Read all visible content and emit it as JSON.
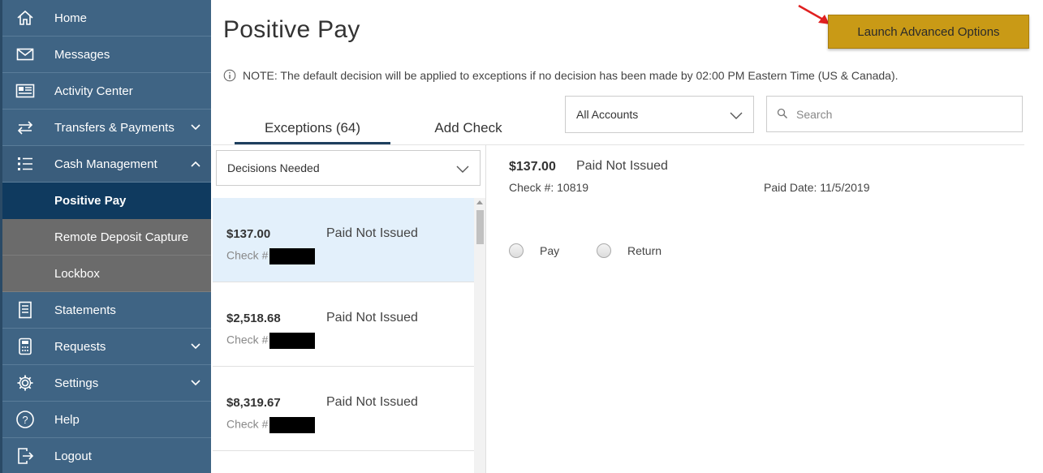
{
  "sidebar": {
    "items": [
      {
        "label": "Home",
        "icon": "home-icon",
        "chevron": false
      },
      {
        "label": "Messages",
        "icon": "envelope-icon",
        "chevron": false
      },
      {
        "label": "Activity Center",
        "icon": "newspaper-icon",
        "chevron": false
      },
      {
        "label": "Transfers & Payments",
        "icon": "transfer-arrows-icon",
        "chevron": true
      },
      {
        "label": "Cash Management",
        "icon": "list-icon",
        "chevron": true
      },
      {
        "label": "Positive Pay",
        "sub": true,
        "active": true
      },
      {
        "label": "Remote Deposit Capture",
        "sub": true
      },
      {
        "label": "Lockbox",
        "sub": true
      },
      {
        "label": "Statements",
        "icon": "document-icon",
        "chevron": false
      },
      {
        "label": "Requests",
        "icon": "calculator-icon",
        "chevron": true
      },
      {
        "label": "Settings",
        "icon": "gear-icon",
        "chevron": true
      },
      {
        "label": "Help",
        "icon": "question-icon",
        "chevron": false
      },
      {
        "label": "Logout",
        "icon": "logout-icon",
        "chevron": false
      }
    ]
  },
  "header": {
    "title": "Positive Pay",
    "launch_button": "Launch Advanced Options",
    "note": "NOTE: The default decision will be applied to exceptions if no decision has been made by 02:00 PM Eastern Time (US & Canada)."
  },
  "tabs": {
    "exceptions": "Exceptions (64)",
    "add_check": "Add Check"
  },
  "filters": {
    "accounts_value": "All Accounts",
    "search_placeholder": "Search",
    "decisions_value": "Decisions Needed"
  },
  "exceptions": [
    {
      "amount": "$137.00",
      "status": "Paid Not Issued",
      "check_label": "Check #"
    },
    {
      "amount": "$2,518.68",
      "status": "Paid Not Issued",
      "check_label": "Check #"
    },
    {
      "amount": "$8,319.67",
      "status": "Paid Not Issued",
      "check_label": "Check #"
    }
  ],
  "detail": {
    "amount": "$137.00",
    "status": "Paid Not Issued",
    "check_number": "Check #: 10819",
    "paid_date": "Paid Date: 11/5/2019",
    "pay_label": "Pay",
    "return_label": "Return"
  },
  "colors": {
    "sidebar_bg": "#3f6484",
    "sidebar_active": "#0f3a5f",
    "sidebar_sub": "#6b6b6b",
    "launch_button": "#c99a16",
    "selected_row": "#e3f0fb",
    "annotation_arrow": "#e02020"
  }
}
